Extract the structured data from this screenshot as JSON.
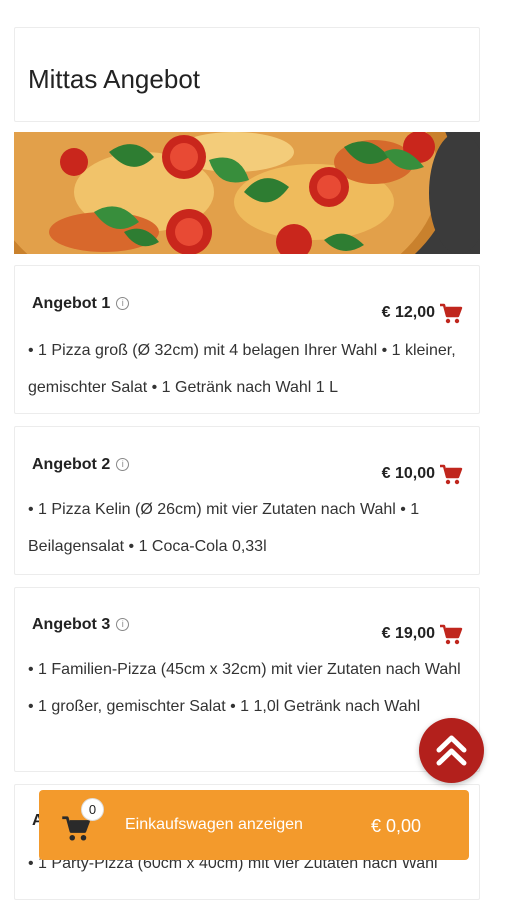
{
  "page": {
    "title": "Mittas Angebot"
  },
  "offers": [
    {
      "title": "Angebot 1",
      "price": "€ 12,00",
      "description": "• 1 Pizza groß (Ø 32cm) mit 4 belagen Ihrer Wahl • 1 kleiner, gemischter Salat • 1 Getränk nach Wahl 1 L"
    },
    {
      "title": "Angebot 2",
      "price": "€ 10,00",
      "description": "• 1 Pizza Kelin (Ø 26cm) mit vier Zutaten nach Wahl • 1 Beilagensalat • 1 Coca-Cola 0,33l"
    },
    {
      "title": "Angebot 3",
      "price": "€ 19,00",
      "description": "• 1 Familien-Pizza (45cm x 32cm) mit vier Zutaten nach Wahl • 1 großer, gemischter Salat • 1 1,0l Getränk nach Wahl"
    },
    {
      "title": "A",
      "price": "",
      "description": "• 1 Party-Pizza (60cm x 40cm) mit vier Zutaten nach Wahl"
    }
  ],
  "cart": {
    "count": "0",
    "label": "Einkaufswagen anzeigen",
    "total": "€ 0,00"
  },
  "icons": {
    "info": "info-icon",
    "cart": "cart-icon",
    "scroll_top": "double-chevron-up-icon"
  },
  "colors": {
    "accent": "#b3201c",
    "cart_bar": "#f39a2c"
  }
}
